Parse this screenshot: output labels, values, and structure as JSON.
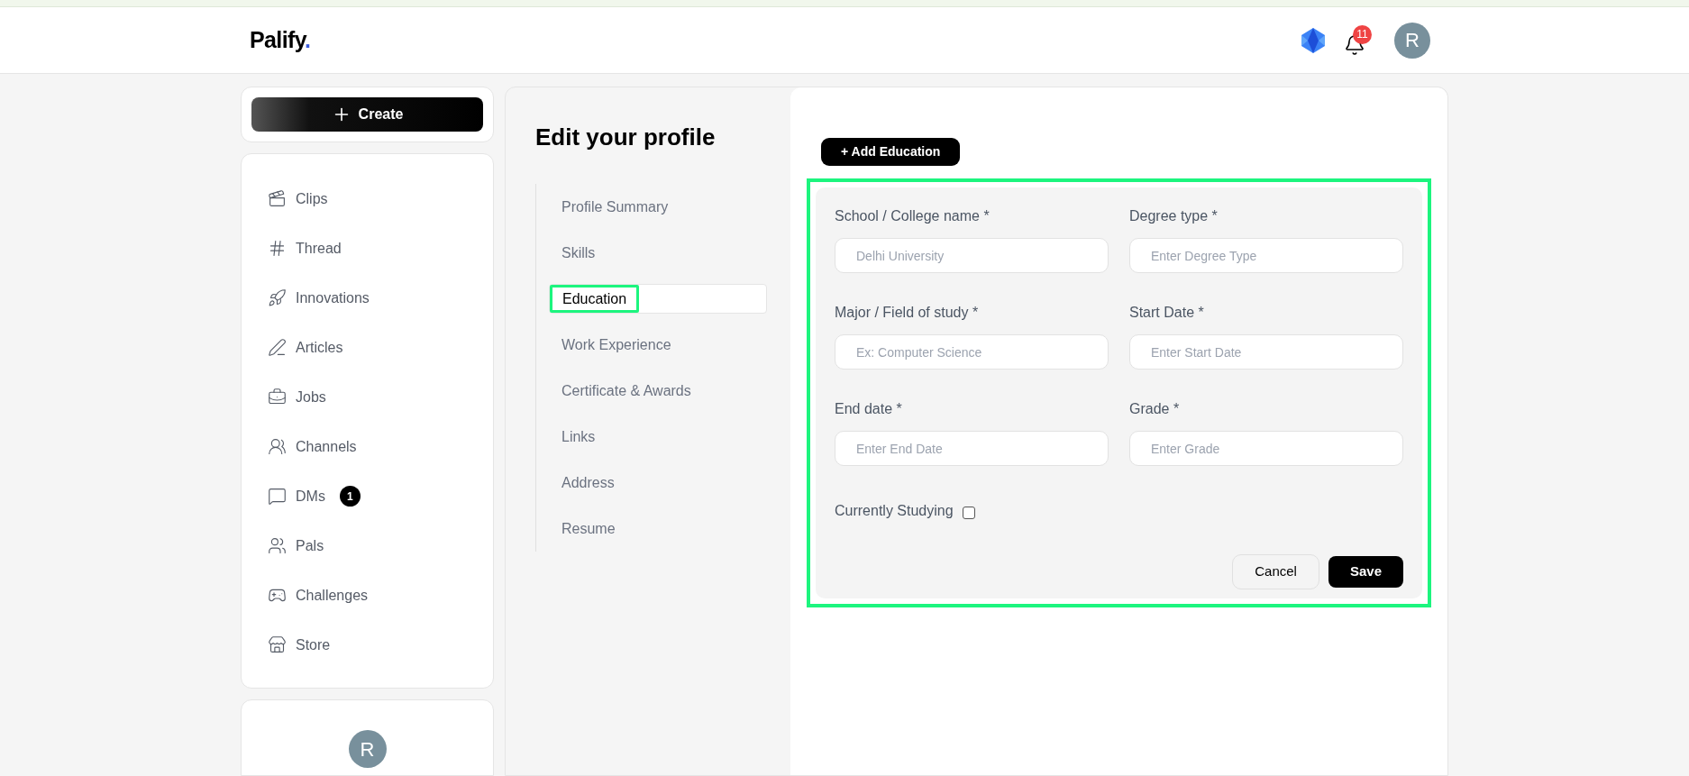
{
  "header": {
    "logo": "Palify",
    "logo_dot": ".",
    "notifications_count": "11",
    "avatar_letter": "R"
  },
  "sidebar": {
    "create_label": "Create",
    "items": [
      {
        "kind": "clips",
        "label": "Clips"
      },
      {
        "kind": "thread",
        "label": "Thread"
      },
      {
        "kind": "innovations",
        "label": "Innovations"
      },
      {
        "kind": "articles",
        "label": "Articles"
      },
      {
        "kind": "jobs",
        "label": "Jobs"
      },
      {
        "kind": "channels",
        "label": "Channels"
      },
      {
        "kind": "dms",
        "label": "DMs",
        "badge": "1"
      },
      {
        "kind": "pals",
        "label": "Pals"
      },
      {
        "kind": "challenges",
        "label": "Challenges"
      },
      {
        "kind": "store",
        "label": "Store"
      }
    ],
    "profile_avatar": "R"
  },
  "profile_nav": {
    "title": "Edit your profile",
    "items": [
      {
        "label": "Profile Summary",
        "selected": false
      },
      {
        "label": "Skills",
        "selected": false
      },
      {
        "label": "Education",
        "selected": true
      },
      {
        "label": "Work Experience",
        "selected": false
      },
      {
        "label": "Certificate & Awards",
        "selected": false
      },
      {
        "label": "Links",
        "selected": false
      },
      {
        "label": "Address",
        "selected": false
      },
      {
        "label": "Resume",
        "selected": false
      }
    ]
  },
  "education": {
    "add_button": "+ Add Education",
    "fields": [
      {
        "label": "School / College name *",
        "placeholder": "Delhi University"
      },
      {
        "label": "Degree type *",
        "placeholder": "Enter Degree Type"
      },
      {
        "label": "Major / Field of study *",
        "placeholder": "Ex: Computer Science"
      },
      {
        "label": "Start Date *",
        "placeholder": "Enter Start Date"
      },
      {
        "label": "End date *",
        "placeholder": "Enter End Date"
      },
      {
        "label": "Grade *",
        "placeholder": "Enter Grade"
      }
    ],
    "currently_studying": {
      "label": "Currently Studying",
      "checked": false
    },
    "cancel": "Cancel",
    "save": "Save"
  }
}
